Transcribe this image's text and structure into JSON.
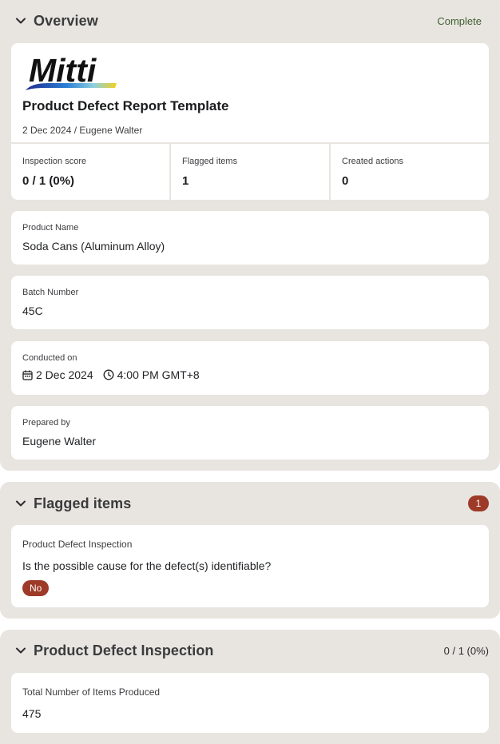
{
  "overview": {
    "title": "Overview",
    "status": "Complete",
    "logo_text": "Mitti",
    "report_title": "Product Defect Report Template",
    "report_subtitle": "2 Dec 2024 / Eugene Walter",
    "stats": [
      {
        "label": "Inspection score",
        "value": "0 / 1 (0%)"
      },
      {
        "label": "Flagged items",
        "value": "1"
      },
      {
        "label": "Created actions",
        "value": "0"
      }
    ],
    "product_name": {
      "label": "Product Name",
      "value": "Soda Cans (Aluminum Alloy)"
    },
    "batch_number": {
      "label": "Batch Number",
      "value": "45C"
    },
    "conducted_on": {
      "label": "Conducted on",
      "date": "2 Dec 2024",
      "time": "4:00 PM GMT+8"
    },
    "prepared_by": {
      "label": "Prepared by",
      "value": "Eugene Walter"
    }
  },
  "flagged": {
    "title": "Flagged items",
    "count": "1",
    "item": {
      "section": "Product Defect Inspection",
      "question": "Is the possible cause for the defect(s) identifiable?",
      "answer": "No"
    }
  },
  "inspection": {
    "title": "Product Defect Inspection",
    "score": "0 / 1 (0%)",
    "field": {
      "label": "Total Number of Items Produced",
      "value": "475"
    }
  },
  "colors": {
    "section_bg": "#e8e5e0",
    "card_bg": "#ffffff",
    "complete_text": "#3f5f32",
    "flag_badge": "#9e3a28"
  }
}
